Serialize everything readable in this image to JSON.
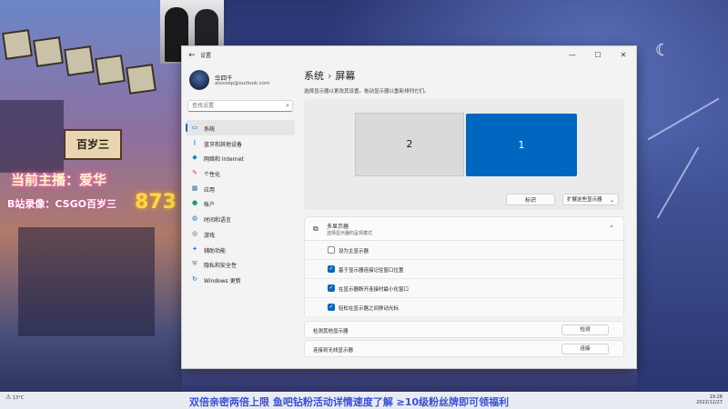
{
  "stream": {
    "host_line": "当前主播：爱华",
    "replay_line": "B站录像：CSGO百岁三",
    "sign_text": "百岁三",
    "neon_text": "873",
    "ticker": "双倍亲密两倍上限  鱼吧钻粉活动详情速度了解  ≥10级粉丝牌即可领福利"
  },
  "window": {
    "title": "设置",
    "back_icon": "←",
    "controls": [
      "—",
      "☐",
      "✕"
    ]
  },
  "user": {
    "name": "华四千",
    "email": "aixxsep@outlook.com"
  },
  "search": {
    "placeholder": "查找设置"
  },
  "nav": {
    "items": [
      {
        "label": "系统",
        "icon": "monitor-icon",
        "glyph": "▭",
        "color": "#0067c0"
      },
      {
        "label": "蓝牙和其他设备",
        "icon": "bluetooth-icon",
        "glyph": "ᛒ",
        "color": "#0067c0"
      },
      {
        "label": "网络和 Internet",
        "icon": "wifi-icon",
        "glyph": "◆",
        "color": "#0a84d6"
      },
      {
        "label": "个性化",
        "icon": "brush-icon",
        "glyph": "✎",
        "color": "#c24f2e"
      },
      {
        "label": "应用",
        "icon": "apps-icon",
        "glyph": "▦",
        "color": "#3a6ea5"
      },
      {
        "label": "帐户",
        "icon": "account-icon",
        "glyph": "●",
        "color": "#1c9b6a"
      },
      {
        "label": "时间和语言",
        "icon": "globe-icon",
        "glyph": "◍",
        "color": "#1173c6"
      },
      {
        "label": "游戏",
        "icon": "gamepad-icon",
        "glyph": "◎",
        "color": "#555555"
      },
      {
        "label": "辅助功能",
        "icon": "accessibility-icon",
        "glyph": "✦",
        "color": "#1a6ec0"
      },
      {
        "label": "隐私和安全性",
        "icon": "shield-icon",
        "glyph": "⛨",
        "color": "#6b6b6b"
      },
      {
        "label": "Windows 更新",
        "icon": "update-icon",
        "glyph": "↻",
        "color": "#0067c0"
      }
    ],
    "active_index": 0
  },
  "page": {
    "breadcrumb_parent": "系统",
    "breadcrumb_sep": "›",
    "breadcrumb_current": "屏幕",
    "hint": "选择显示器以更改其设置。拖动显示器以重新排列它们。"
  },
  "displays": {
    "monitor_2": "2",
    "monitor_1": "1",
    "identify_label": "标识",
    "mode_select": "扩展这些显示器",
    "mode_chevron": "⌄"
  },
  "multi": {
    "title": "多显示器",
    "subtitle": "选择显示器的呈现模式",
    "chevron": "⌃",
    "checkboxes": [
      {
        "label": "设为主显示器",
        "checked": false
      },
      {
        "label": "基于显示器连接记住窗口位置",
        "checked": true
      },
      {
        "label": "在显示器断开连接时最小化窗口",
        "checked": true
      },
      {
        "label": "轻松在显示器之间移动光标",
        "checked": true
      }
    ],
    "check_glyph": "✓"
  },
  "detect_row": {
    "label": "检测其他显示器",
    "button": "检测"
  },
  "connect_row": {
    "label": "连接到无线显示器",
    "button": "连接"
  },
  "taskbar": {
    "left_icon": "⚠",
    "left_label": "13°C",
    "time": "19:28",
    "date": "2022/12/27"
  },
  "colors": {
    "accent": "#0067c0",
    "ticker": "#3a50d8"
  }
}
